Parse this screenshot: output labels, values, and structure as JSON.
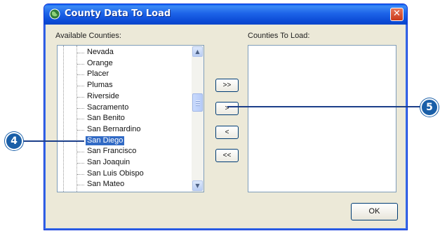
{
  "window": {
    "title": "County Data To Load",
    "close_glyph": "✕"
  },
  "available": {
    "label": "Available Counties:",
    "items": [
      "Nevada",
      "Orange",
      "Placer",
      "Plumas",
      "Riverside",
      "Sacramento",
      "San Benito",
      "San Bernardino",
      "San Diego",
      "San Francisco",
      "San Joaquin",
      "San Luis Obispo",
      "San Mateo"
    ],
    "selected": "San Diego"
  },
  "to_load": {
    "label": "Counties To Load:"
  },
  "buttons": {
    "add_all": ">>",
    "add": ">",
    "remove": "<",
    "remove_all": "<<",
    "ok": "OK"
  },
  "scrollbar": {
    "up_glyph": "▲",
    "down_glyph": "▼"
  },
  "callouts": {
    "four": "4",
    "five": "5"
  },
  "icons": {
    "app": "globe-icon"
  }
}
